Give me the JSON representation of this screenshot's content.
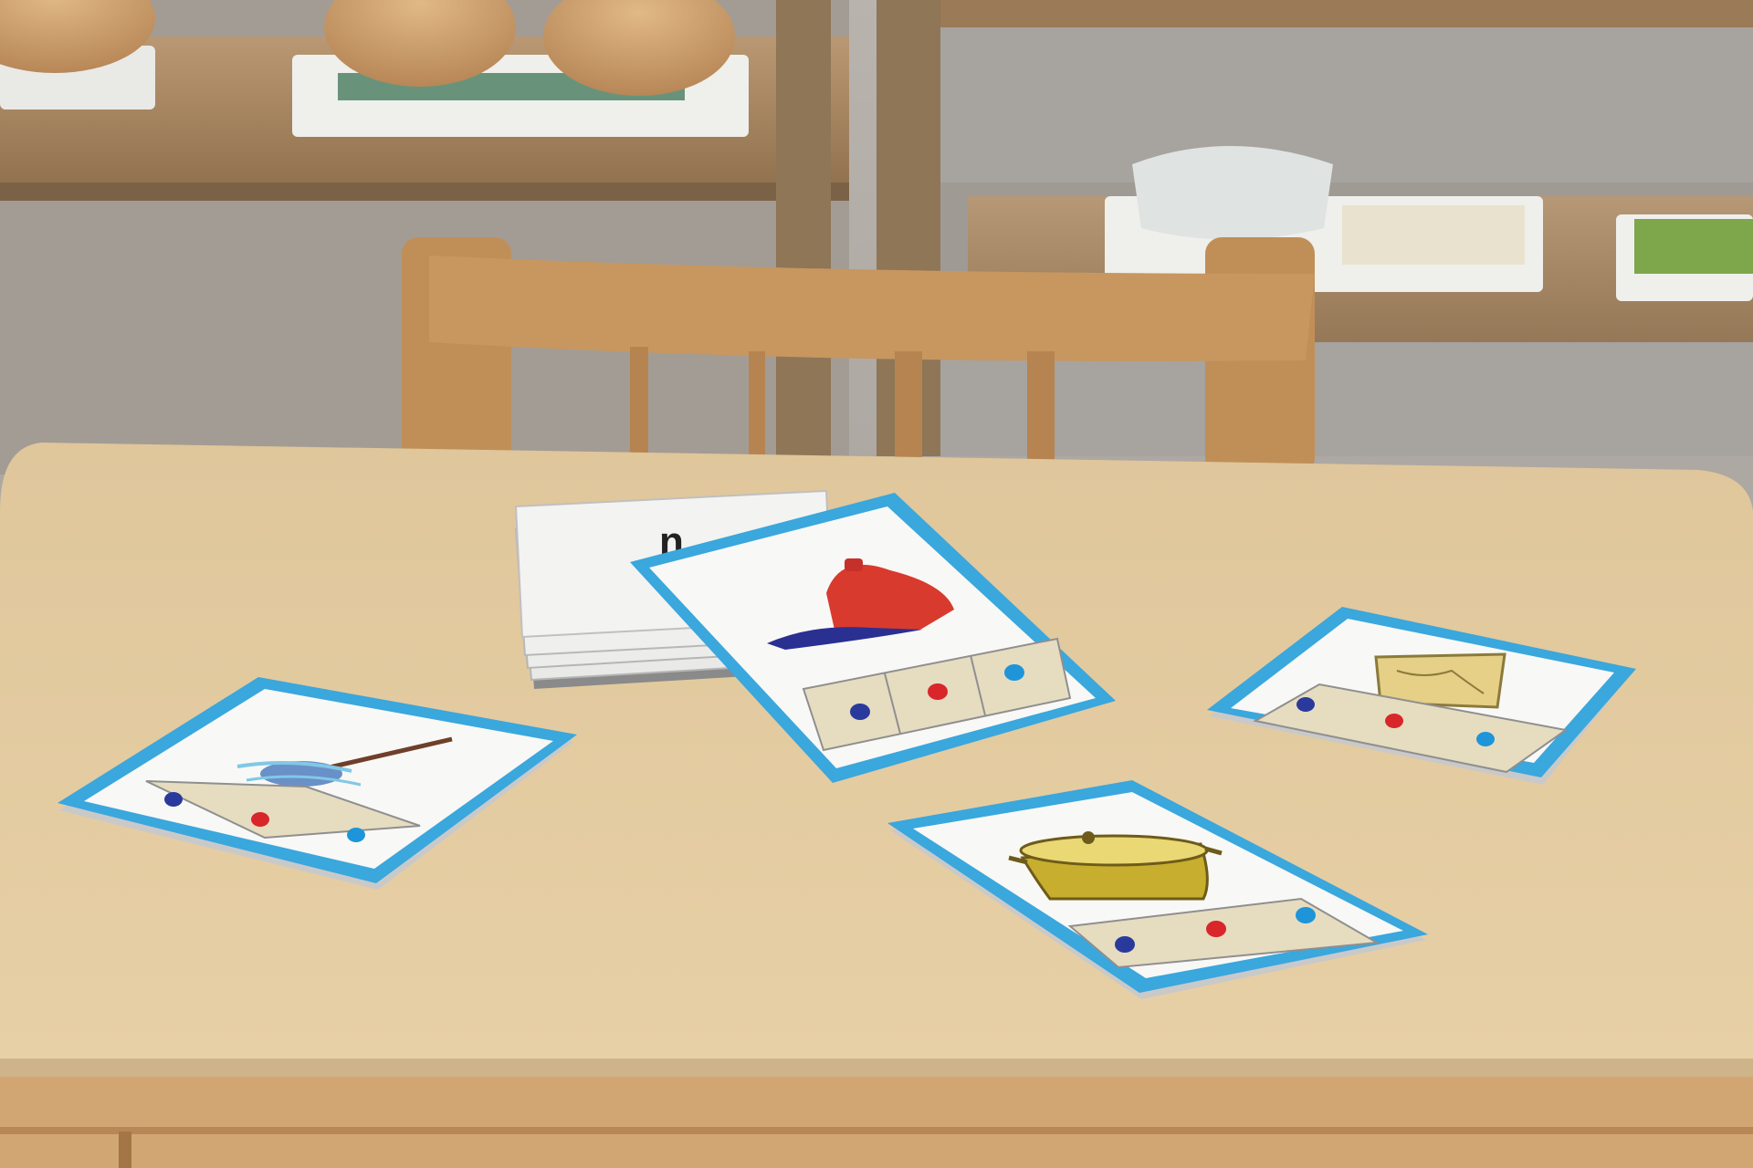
{
  "scene": {
    "description_colors": {
      "wall": "#b4b0ab",
      "shelf_wood": "#a8875f",
      "table_top": "#e2c9a0",
      "table_edge": "#cfae7c",
      "chair_wood": "#c28f58",
      "card_border": "#3aa7dd",
      "card_face": "#f8f8f6",
      "slot_fill": "#e6dcc0",
      "dot_1": "#2a3a9c",
      "dot_2": "#d8262b",
      "dot_3": "#1e95d9"
    },
    "cards": [
      {
        "picture": "mop-icon"
      },
      {
        "picture": "cap-icon"
      },
      {
        "picture": "map-icon"
      },
      {
        "picture": "pot-icon"
      }
    ],
    "stack": {
      "partial_letters": "n"
    }
  }
}
